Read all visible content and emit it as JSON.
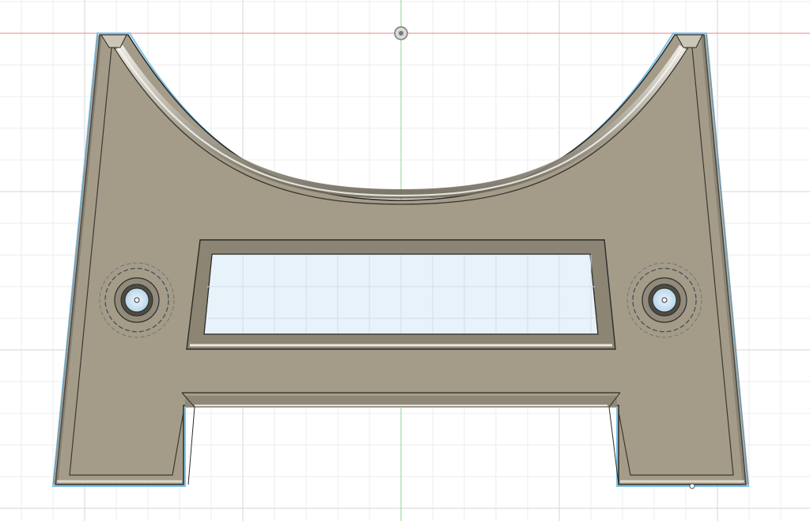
{
  "app": {
    "view": "top",
    "workspace": "cad-modeling-canvas"
  },
  "canvas": {
    "background": "#ffffff",
    "grid_minor_color": "#ececec",
    "grid_major_color": "#d6d6d6",
    "x_axis_color": "#e88a8a",
    "y_axis_color": "#8fd68f"
  },
  "model": {
    "name": "plate-with-arch-cutout",
    "body_color": "#a49c89",
    "edge_color": "#2b2b28",
    "window_fill": "#e8f2fb",
    "hole_fill": "#cfe5f5",
    "selection_outline": "#7fc2ea",
    "features": [
      "arch-cutout",
      "rectangular-window",
      "left-mounting-hole",
      "right-mounting-hole",
      "bottom-slot"
    ]
  },
  "icons": {
    "origin": "origin-icon",
    "vertex": "vertex-point-icon"
  }
}
